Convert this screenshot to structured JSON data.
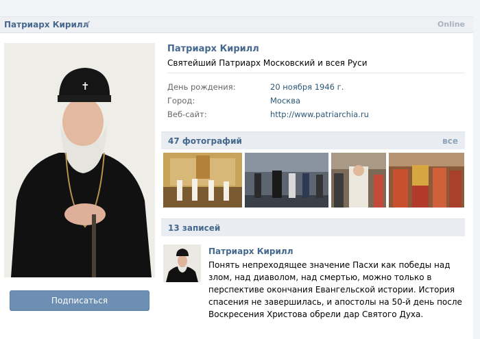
{
  "topbar": {
    "name": "Патриарх Кирилл",
    "online": "Online"
  },
  "profile": {
    "name": "Патриарх Кирилл",
    "status": "Святейший Патриарх Московский и всея Руси",
    "rows": [
      {
        "label": "День рождения:",
        "value": "20 ноября 1946 г."
      },
      {
        "label": "Город:",
        "value": "Москва"
      },
      {
        "label": "Веб-сайт:",
        "value": "http://www.patriarchia.ru"
      }
    ],
    "subscribe": "Подписаться"
  },
  "photos": {
    "title": "47 фотографий",
    "all": "все"
  },
  "wall": {
    "title": "13 записей",
    "post": {
      "author": "Патриарх Кирилл",
      "text": "Понять непреходящее значение Пасхи как победы над злом, над диаволом, над смертью, можно только в перспективе окончания Евангельской истории. История спасения не завершилась, и апостолы на 50-й день после Воскресения Христова обрели дар Святого Духа."
    }
  },
  "icons": [
    "verified-check-icon",
    "cross-icon"
  ],
  "colors": {
    "link": "#45688e",
    "button": "#6d8fb3",
    "bar": "#e9edf1"
  }
}
